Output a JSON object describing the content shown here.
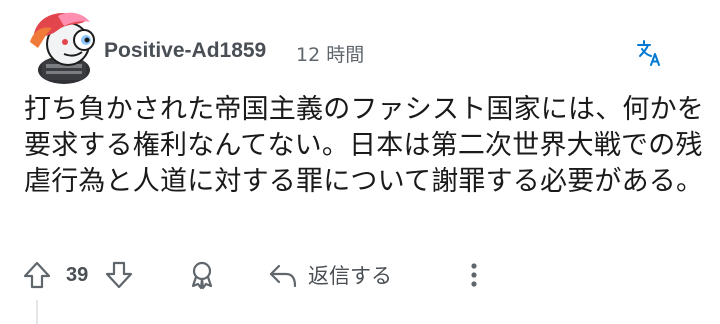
{
  "comment": {
    "author": "Positive-Ad1859",
    "time": "12 時間",
    "body": "打ち負かされた帝国主義のファシスト国家には、何かを要求する権利なんてない。日本は第二次世界大戦での残虐行為と人道に対する罪について謝罪する必要がある。"
  },
  "actions": {
    "score": "39",
    "reply_label": "返信する"
  },
  "icons": {
    "translate": "translate-icon",
    "upvote": "upvote-arrow-icon",
    "downvote": "downvote-arrow-icon",
    "award": "award-icon",
    "reply": "reply-arrow-icon",
    "more": "more-vertical-dots-icon"
  },
  "colors": {
    "accent_blue": "#0079d3",
    "icon_gray": "#5f666c",
    "text_dark": "#1a1a1b"
  }
}
